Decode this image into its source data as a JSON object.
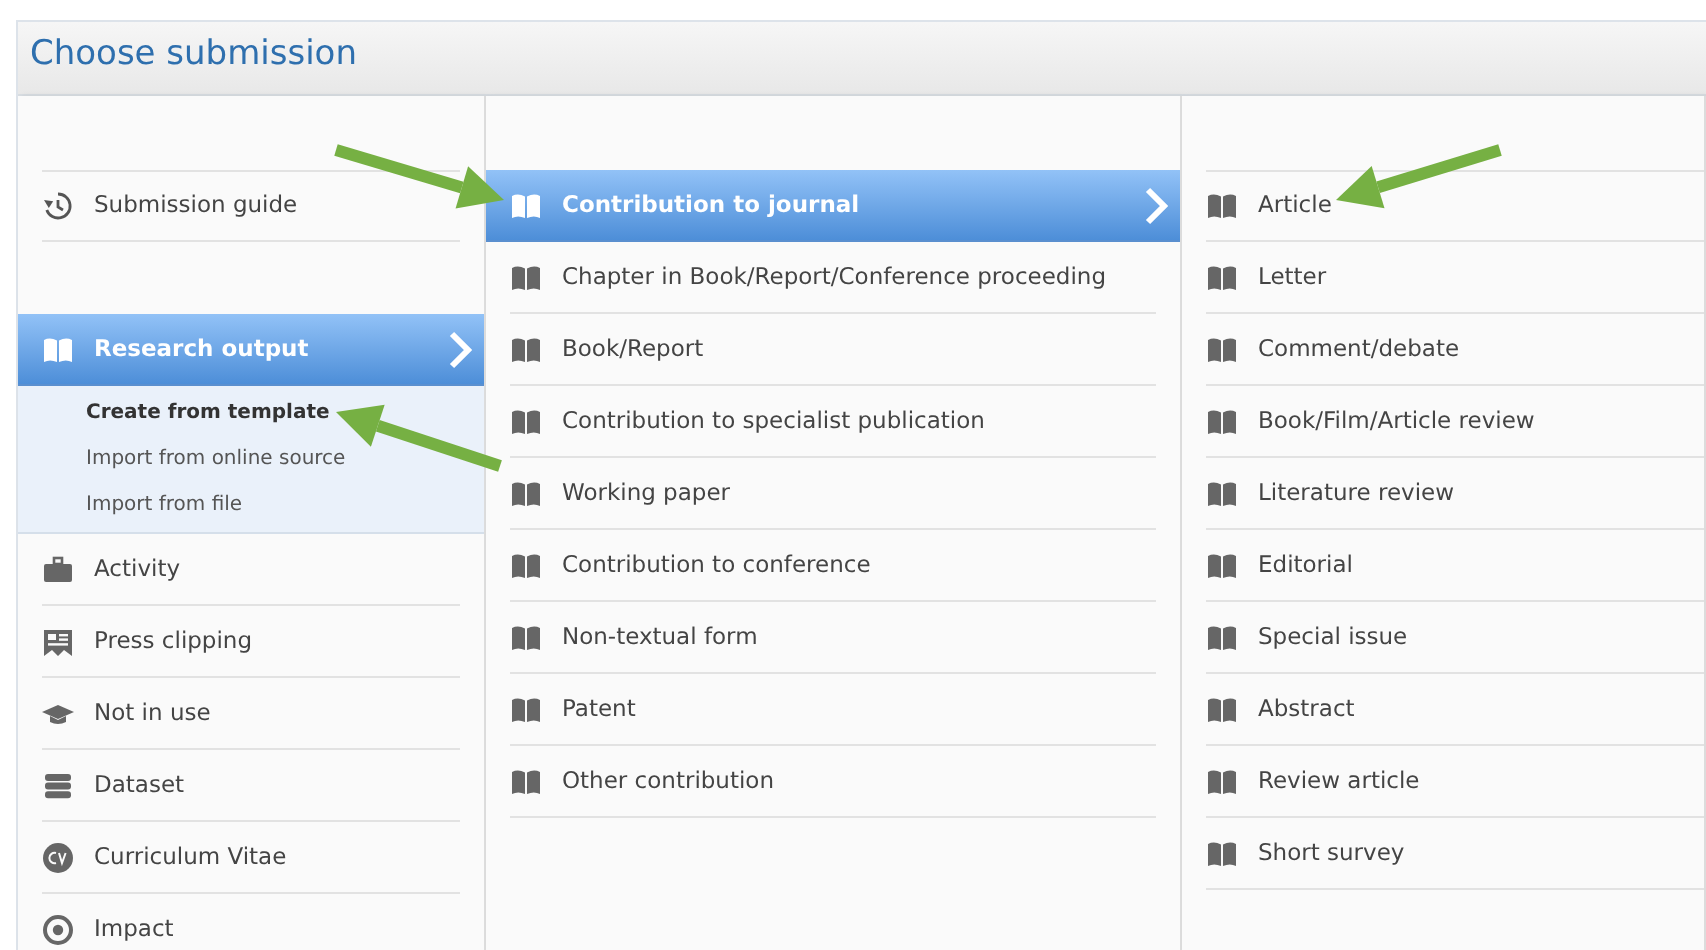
{
  "dialog": {
    "title": "Choose submission"
  },
  "guide": {
    "label": "Submission guide",
    "kind": "history"
  },
  "categories": [
    {
      "label": "Research output",
      "kind": "book",
      "selected": true,
      "subitems": [
        {
          "label": "Create from template",
          "selected": true
        },
        {
          "label": "Import from online source",
          "selected": false
        },
        {
          "label": "Import from file",
          "selected": false
        }
      ]
    },
    {
      "label": "Activity",
      "kind": "briefcase",
      "selected": false
    },
    {
      "label": "Press clipping",
      "kind": "clipping",
      "selected": false
    },
    {
      "label": "Not in use",
      "kind": "mortarboard",
      "selected": false
    },
    {
      "label": "Dataset",
      "kind": "database",
      "selected": false
    },
    {
      "label": "Curriculum Vitae",
      "kind": "cv",
      "selected": false
    },
    {
      "label": "Impact",
      "kind": "target",
      "selected": false
    }
  ],
  "types": [
    {
      "label": "Contribution to journal",
      "selected": true
    },
    {
      "label": "Chapter in Book/Report/Conference proceeding",
      "selected": false
    },
    {
      "label": "Book/Report",
      "selected": false
    },
    {
      "label": "Contribution to specialist publication",
      "selected": false
    },
    {
      "label": "Working paper",
      "selected": false
    },
    {
      "label": "Contribution to conference",
      "selected": false
    },
    {
      "label": "Non-textual form",
      "selected": false
    },
    {
      "label": "Patent",
      "selected": false
    },
    {
      "label": "Other contribution",
      "selected": false
    }
  ],
  "subtypes": [
    {
      "label": "Article",
      "selected": false
    },
    {
      "label": "Letter",
      "selected": false
    },
    {
      "label": "Comment/debate",
      "selected": false
    },
    {
      "label": "Book/Film/Article review",
      "selected": false
    },
    {
      "label": "Literature review",
      "selected": false
    },
    {
      "label": "Editorial",
      "selected": false
    },
    {
      "label": "Special issue",
      "selected": false
    },
    {
      "label": "Abstract",
      "selected": false
    },
    {
      "label": "Review article",
      "selected": false
    },
    {
      "label": "Short survey",
      "selected": false
    }
  ]
}
